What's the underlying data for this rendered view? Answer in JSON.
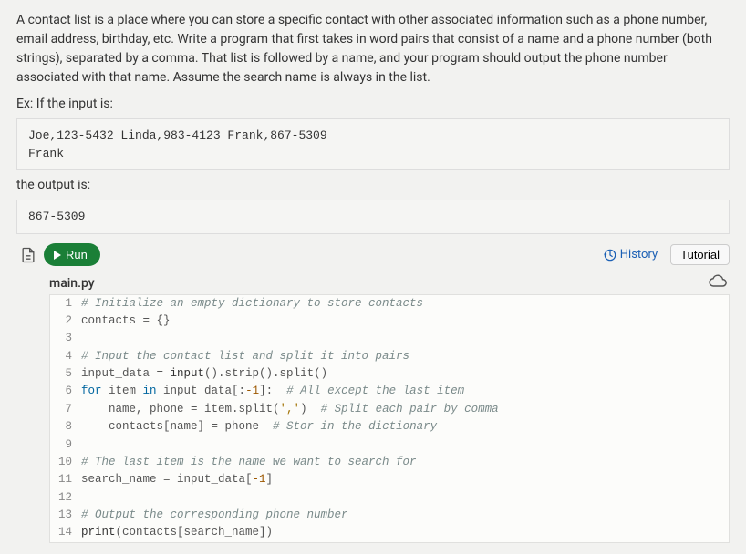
{
  "description": "A contact list is a place where you can store a specific contact with other associated information such as a phone number, email address, birthday, etc. Write a program that first takes in word pairs that consist of a name and a phone number (both strings), separated by a comma. That list is followed by a name, and your program should output the phone number associated with that name. Assume the search name is always in the list.",
  "ex_label": "Ex: If the input is:",
  "input_example": "Joe,123-5432 Linda,983-4123 Frank,867-5309\nFrank",
  "output_label": "the output is:",
  "output_example": "867-5309",
  "run_label": "Run",
  "history_label": "History",
  "tutorial_label": "Tutorial",
  "filename": "main.py",
  "code_lines": [
    {
      "n": "1",
      "html": "<span class='comment'># Initialize an empty dictionary to store contacts</span>"
    },
    {
      "n": "2",
      "html": "contacts = {}"
    },
    {
      "n": "3",
      "html": ""
    },
    {
      "n": "4",
      "html": "<span class='comment'># Input the contact list and split it into pairs</span>"
    },
    {
      "n": "5",
      "html": "input_data = <span class='func'>input</span>().strip().split()"
    },
    {
      "n": "6",
      "html": "<span class='keyword'>for</span> item <span class='keyword'>in</span> input_data[:<span class='num'>-1</span>]:  <span class='comment'># All except the last item</span>"
    },
    {
      "n": "7",
      "html": "    name, phone = item.split(<span class='string'>','</span>)  <span class='comment'># Split each pair by comma</span>"
    },
    {
      "n": "8",
      "html": "    contacts[name] = phone  <span class='comment'># Stor in the dictionary</span>"
    },
    {
      "n": "9",
      "html": ""
    },
    {
      "n": "10",
      "html": "<span class='comment'># The last item is the name we want to search for</span>"
    },
    {
      "n": "11",
      "html": "search_name = input_data[<span class='num'>-1</span>]"
    },
    {
      "n": "12",
      "html": ""
    },
    {
      "n": "13",
      "html": "<span class='comment'># Output the corresponding phone number</span>"
    },
    {
      "n": "14",
      "html": "<span class='func'>print</span>(contacts[search_name])"
    }
  ]
}
